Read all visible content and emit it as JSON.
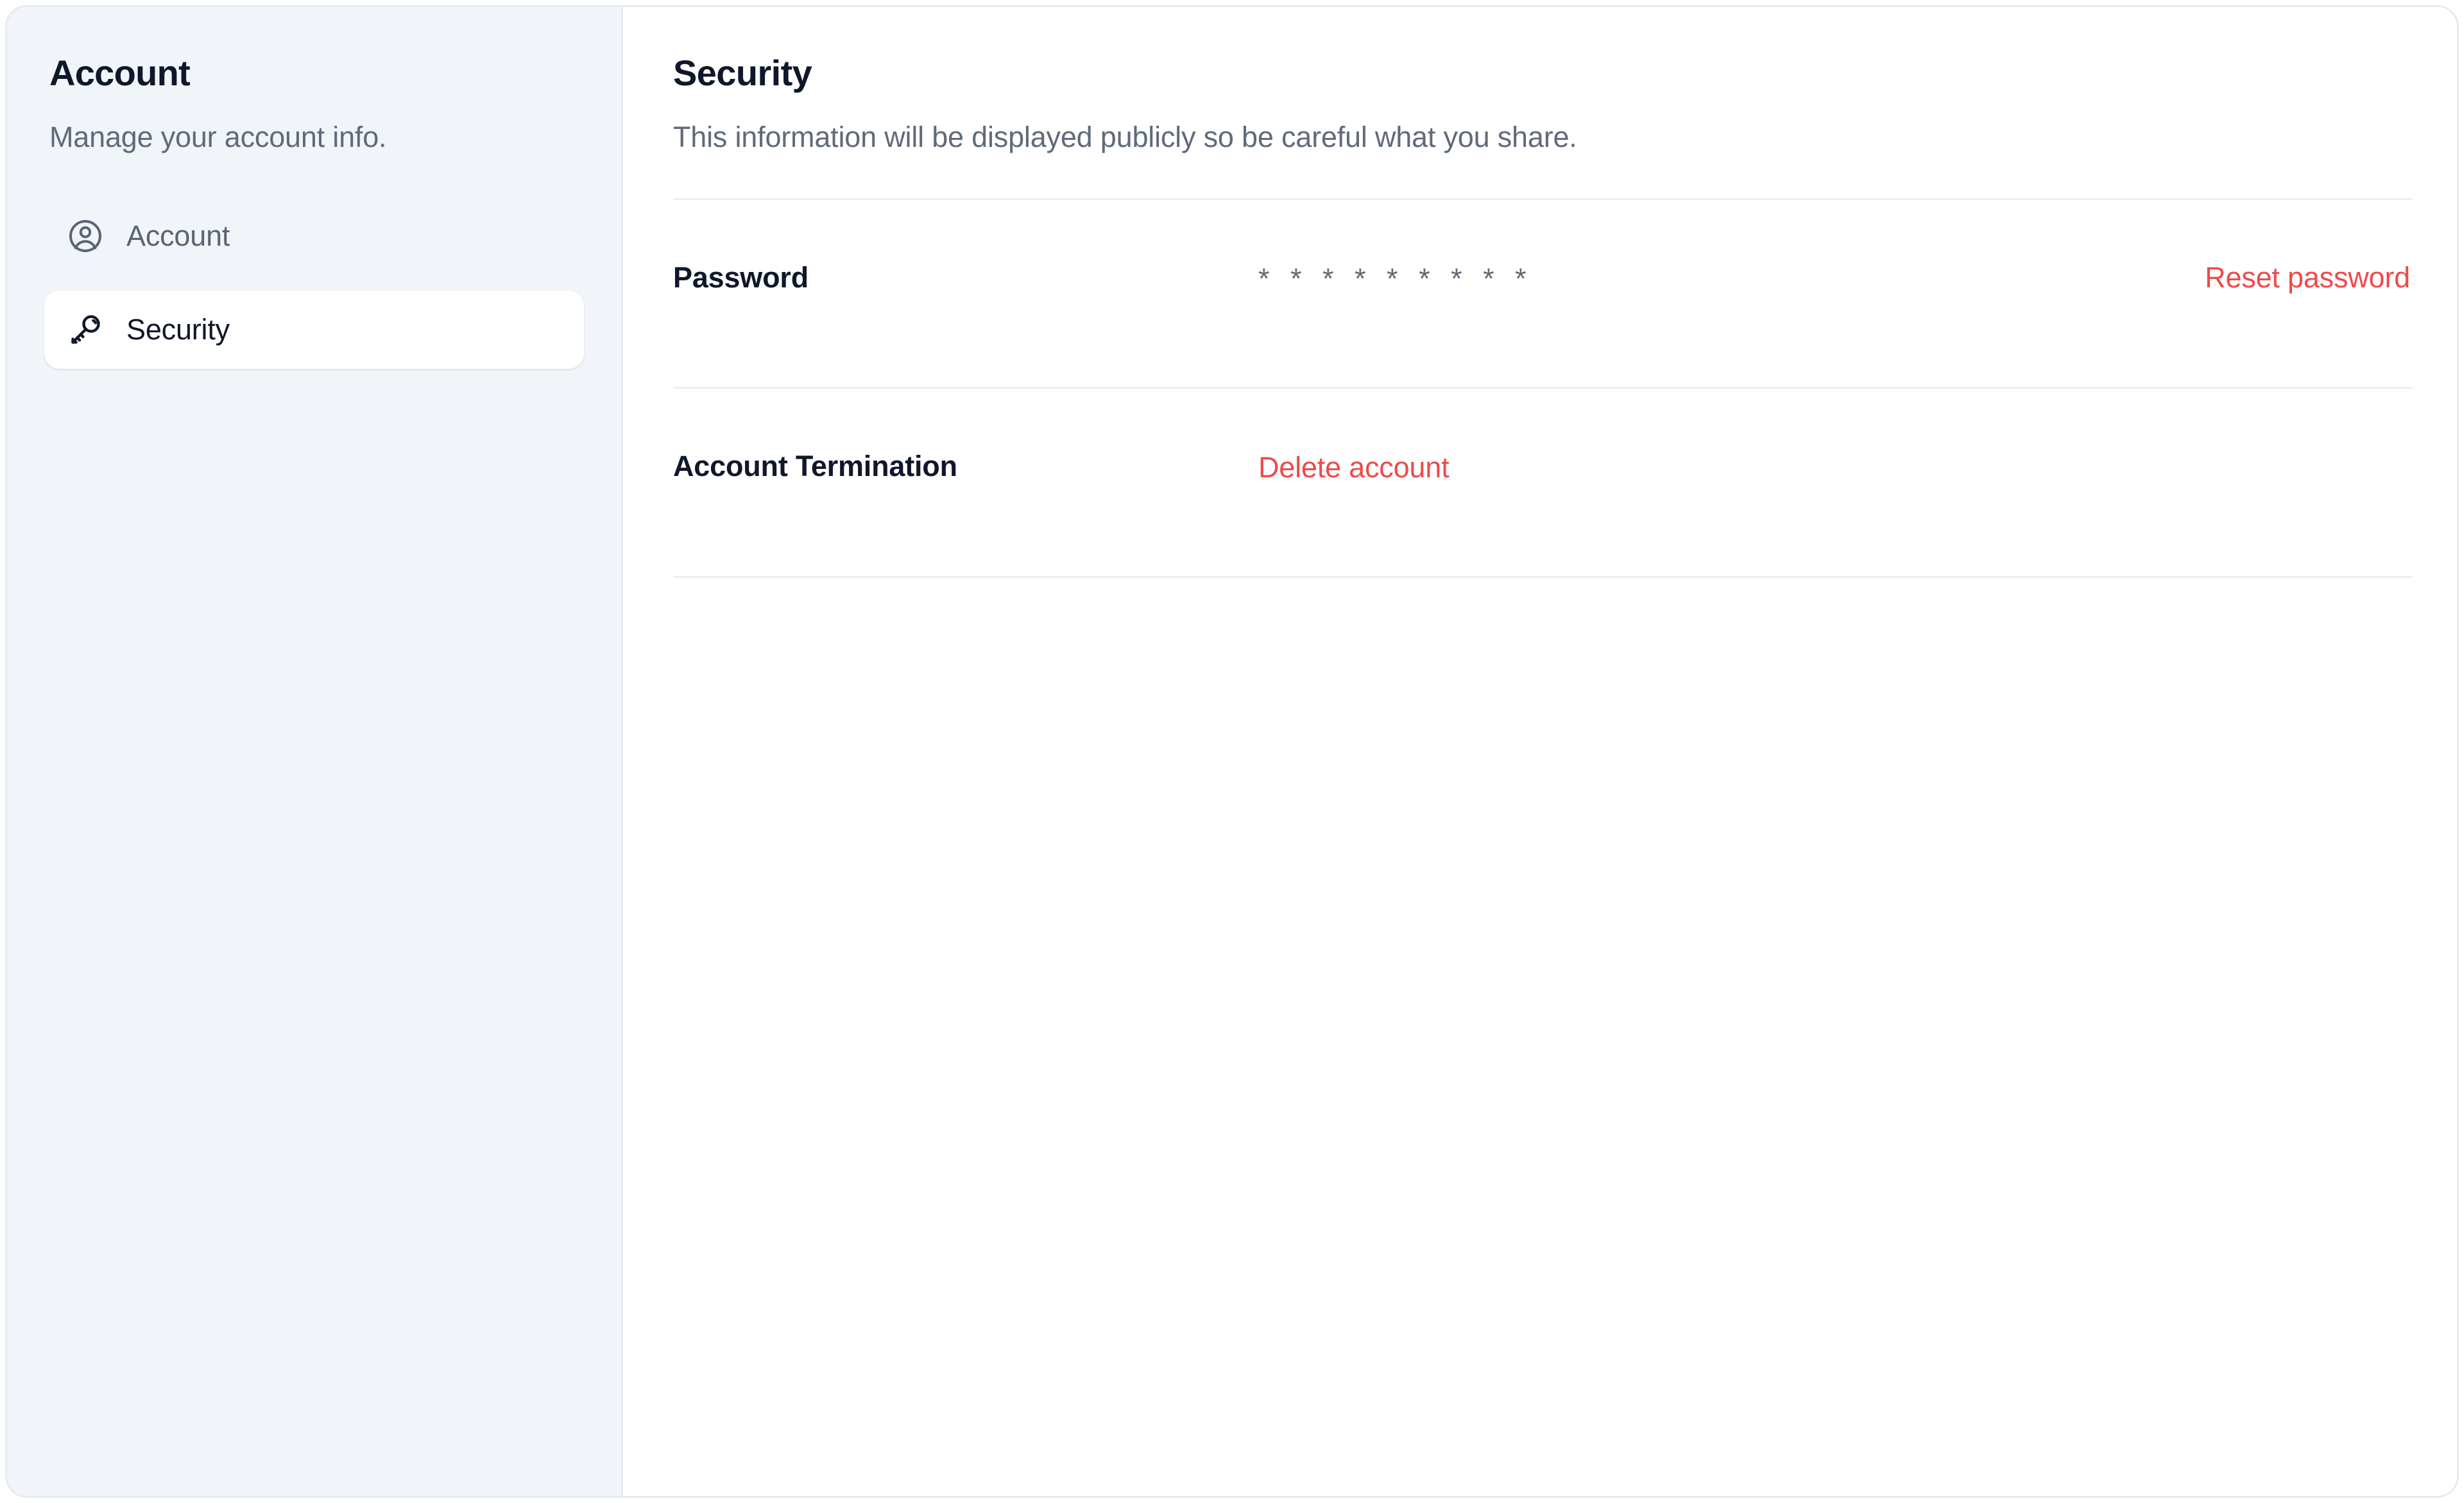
{
  "theme": {
    "page_background": "#ffffff",
    "card_background": "#ffffff",
    "card_border": "#e7ebf0",
    "sidebar_background": "#f1f5f9",
    "active_item_background": "#ffffff",
    "heading_color": "#0f172a",
    "muted_text_color": "#5f6b7a",
    "divider_color": "#eceff3",
    "danger_color": "#ef4a4a"
  },
  "sidebar": {
    "title": "Account",
    "subtitle": "Manage your account info.",
    "items": [
      {
        "id": "account",
        "label": "Account",
        "icon": "user-circle-icon",
        "active": false
      },
      {
        "id": "security",
        "label": "Security",
        "icon": "key-icon",
        "active": true
      }
    ]
  },
  "main": {
    "title": "Security",
    "subtitle": "This information will be displayed publicly so be careful what you share.",
    "rows": [
      {
        "id": "password",
        "label": "Password",
        "value": "* * * * * * * * *",
        "value_is_link": false,
        "action": "Reset password"
      },
      {
        "id": "account-termination",
        "label": "Account Termination",
        "value": "Delete account",
        "value_is_link": true,
        "action": ""
      }
    ]
  }
}
